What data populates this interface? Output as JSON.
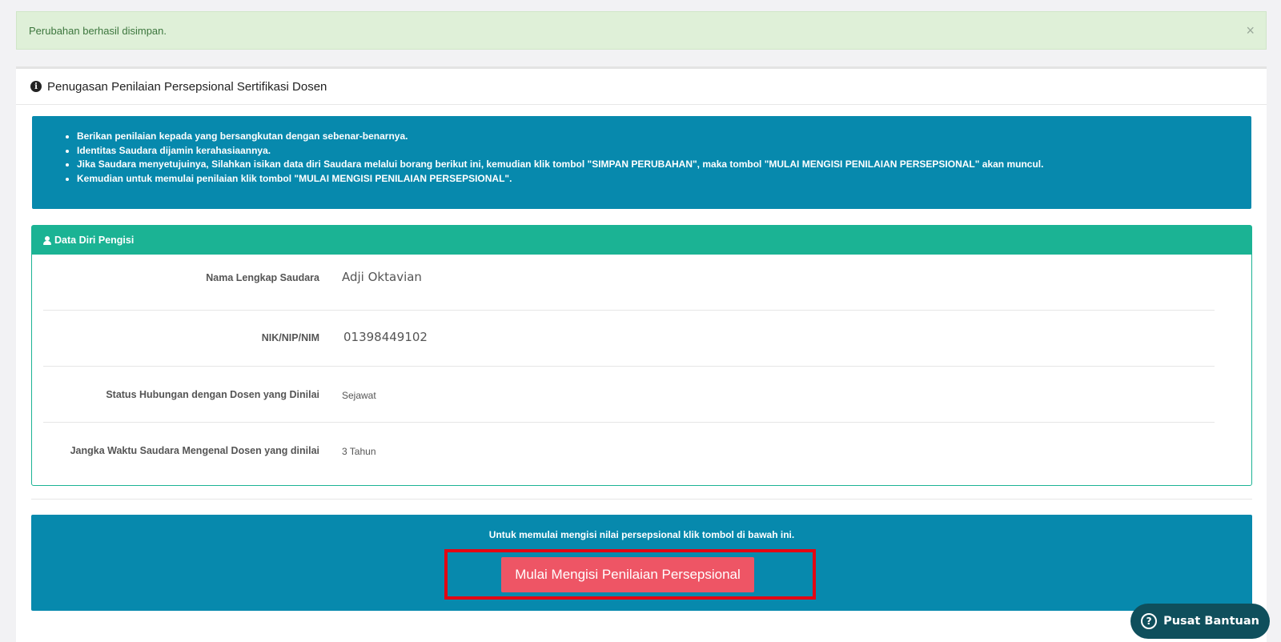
{
  "alert": {
    "message": "Perubahan berhasil disimpan.",
    "close": "×"
  },
  "panel": {
    "title": "Penugasan Penilaian Persepsional Sertifikasi Dosen",
    "icon": "info-circle-icon"
  },
  "instructions": [
    "Berikan penilaian kepada yang bersangkutan dengan sebenar-benarnya.",
    "Identitas Saudara dijamin kerahasiaannya.",
    "Jika Saudara menyetujuinya, Silahkan isikan data diri Saudara melalui borang berikut ini, kemudian klik tombol \"SIMPAN PERUBAHAN\", maka tombol \"MULAI MENGISI PENILAIAN PERSEPSIONAL\" akan muncul.",
    "Kemudian untuk memulai penilaian klik tombol \"MULAI MENGISI PENILAIAN PERSEPSIONAL\"."
  ],
  "data_diri": {
    "heading": "Data Diri Pengisi",
    "icon": "user-icon",
    "fields": [
      {
        "label": "Nama Lengkap Saudara",
        "value": "Adji Oktavian"
      },
      {
        "label": "NIK/NIP/NIM",
        "value": "01398449102"
      },
      {
        "label": "Status Hubungan dengan Dosen yang Dinilai",
        "value": "Sejawat"
      },
      {
        "label": "Jangka Waktu Saudara Mengenal Dosen yang dinilai",
        "value": "3 Tahun"
      }
    ]
  },
  "cta": {
    "text": "Untuk memulai mengisi nilai persepsional klik tombol di bawah ini.",
    "button": "Mulai Mengisi Penilaian Persepsional"
  },
  "help": {
    "label": "Pusat Bantuan",
    "icon": "question-circle-icon"
  },
  "colors": {
    "alert_bg": "#dff0d8",
    "callout_bg": "#0789ad",
    "box_header": "#1bb394",
    "button": "#ee5565",
    "highlight": "#e30613",
    "help_bg": "#0f4f5c"
  }
}
